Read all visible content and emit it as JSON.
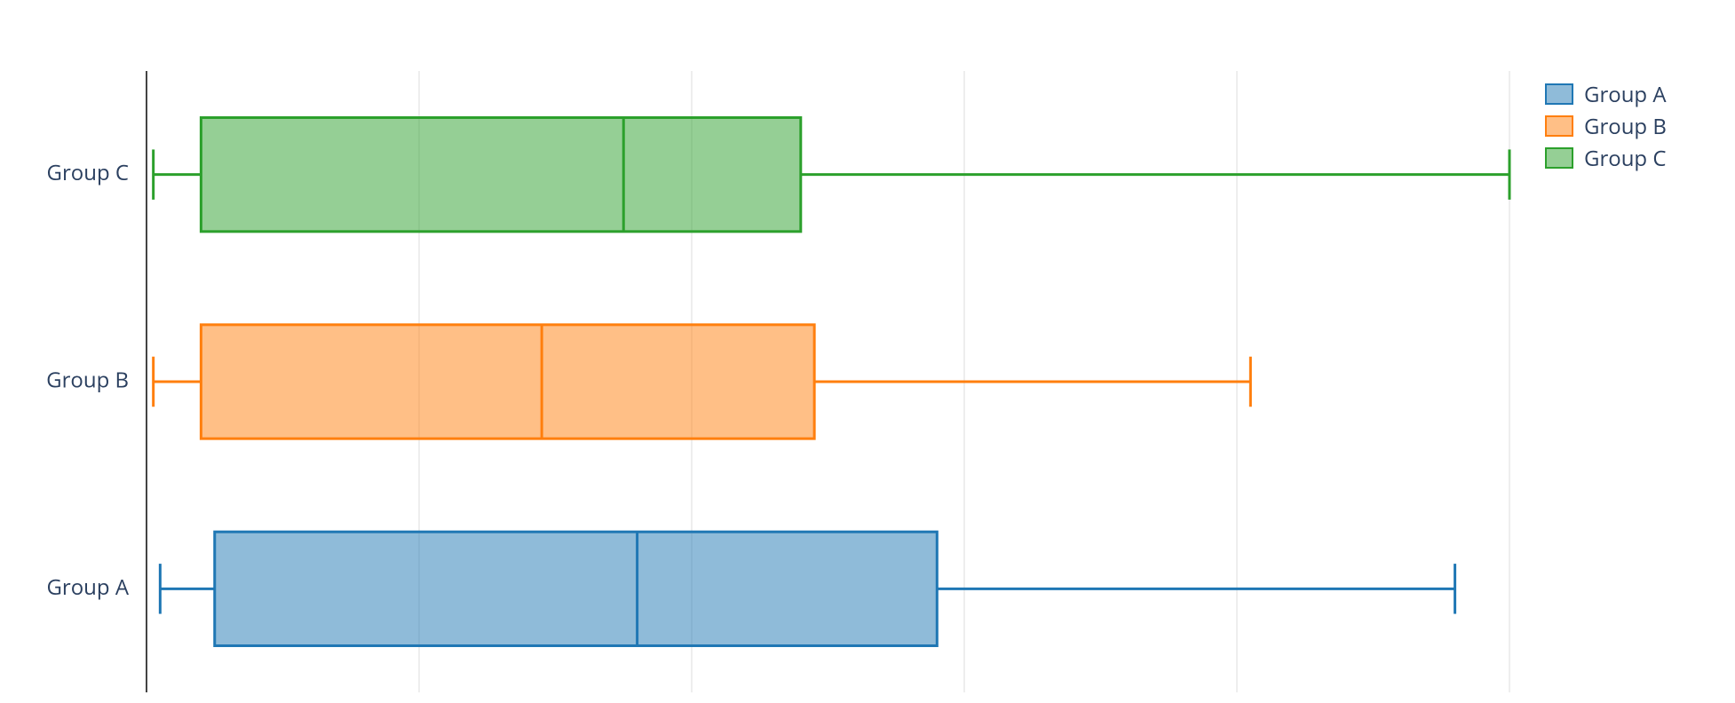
{
  "chart_data": {
    "type": "box",
    "orientation": "horizontal",
    "categories": [
      "Group A",
      "Group B",
      "Group C"
    ],
    "xlim": [
      0,
      1.0
    ],
    "grid_x_ticks": [
      0,
      0.2,
      0.4,
      0.6,
      0.8,
      1.0
    ],
    "series": [
      {
        "name": "Group A",
        "color_stroke": "#1f77b4",
        "color_fill": "rgba(31,119,180,0.5)",
        "min": 0.01,
        "q1": 0.05,
        "median": 0.36,
        "q3": 0.58,
        "max": 0.96
      },
      {
        "name": "Group B",
        "color_stroke": "#ff7f0e",
        "color_fill": "rgba(255,127,14,0.5)",
        "min": 0.005,
        "q1": 0.04,
        "median": 0.29,
        "q3": 0.49,
        "max": 0.81
      },
      {
        "name": "Group C",
        "color_stroke": "#2ca02c",
        "color_fill": "rgba(44,160,44,0.5)",
        "min": 0.005,
        "q1": 0.04,
        "median": 0.35,
        "q3": 0.48,
        "max": 1.0
      }
    ]
  },
  "legend": {
    "items": [
      {
        "label": "Group A"
      },
      {
        "label": "Group B"
      },
      {
        "label": "Group C"
      }
    ]
  },
  "yaxis_labels": {
    "a": "Group A",
    "b": "Group B",
    "c": "Group C"
  }
}
